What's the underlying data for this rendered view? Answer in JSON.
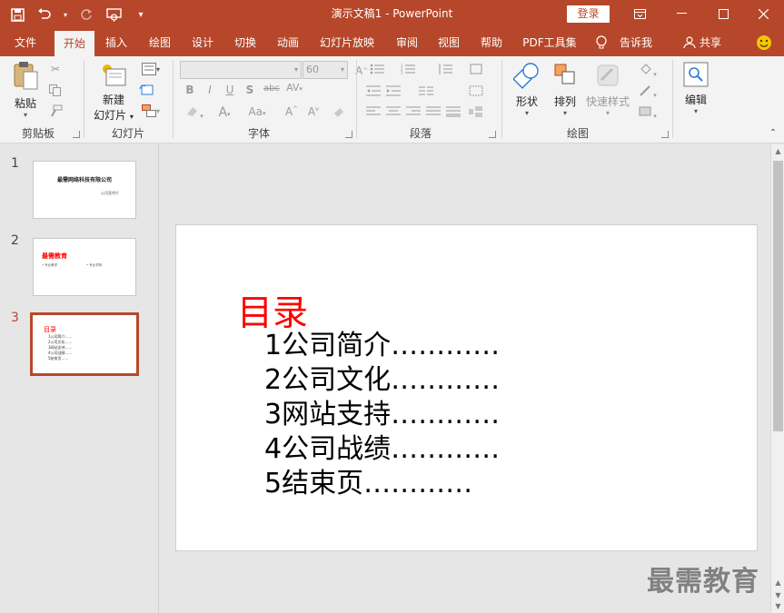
{
  "app": {
    "doc_title": "演示文稿1  -  PowerPoint",
    "login_label": "登录",
    "accent_color": "#b7472a"
  },
  "tabs": [
    {
      "label": "文件"
    },
    {
      "label": "开始"
    },
    {
      "label": "插入"
    },
    {
      "label": "绘图"
    },
    {
      "label": "设计"
    },
    {
      "label": "切换"
    },
    {
      "label": "动画"
    },
    {
      "label": "幻灯片放映"
    },
    {
      "label": "审阅"
    },
    {
      "label": "视图"
    },
    {
      "label": "帮助"
    },
    {
      "label": "PDF工具集"
    },
    {
      "label": "告诉我"
    },
    {
      "label": "共享"
    }
  ],
  "ribbon": {
    "clipboard": {
      "paste_label": "粘贴",
      "group_label": "剪贴板"
    },
    "slides": {
      "new_slide_label": "新建\n幻灯片",
      "new_slide_line1": "新建",
      "new_slide_line2": "幻灯片",
      "group_label": "幻灯片"
    },
    "font": {
      "font_name": "",
      "font_size": "60",
      "group_label": "字体"
    },
    "paragraph": {
      "group_label": "段落"
    },
    "drawing": {
      "shape_label": "形状",
      "arrange_label": "排列",
      "quickstyle_label": "快速样式",
      "group_label": "绘图"
    },
    "editing": {
      "edit_label": "编辑"
    }
  },
  "thumbnails": [
    {
      "number": "1",
      "title": "最需网络科技有限公司",
      "subtitle": "公司宣传片"
    },
    {
      "number": "2",
      "title": "最需教育",
      "col1": "• 专业教学",
      "col2": "• 专业学院"
    },
    {
      "number": "3",
      "title": "目录",
      "items": [
        "1公司简介……",
        "2公司文化……",
        "3网站支持……",
        "4公司战绩……",
        "5结束页……"
      ]
    }
  ],
  "slide": {
    "title": "目录",
    "items": [
      "1公司简介…………",
      "2公司文化…………",
      "3网站支持…………",
      "4公司战绩…………",
      "5结束页…………"
    ]
  },
  "watermark": "最需教育"
}
